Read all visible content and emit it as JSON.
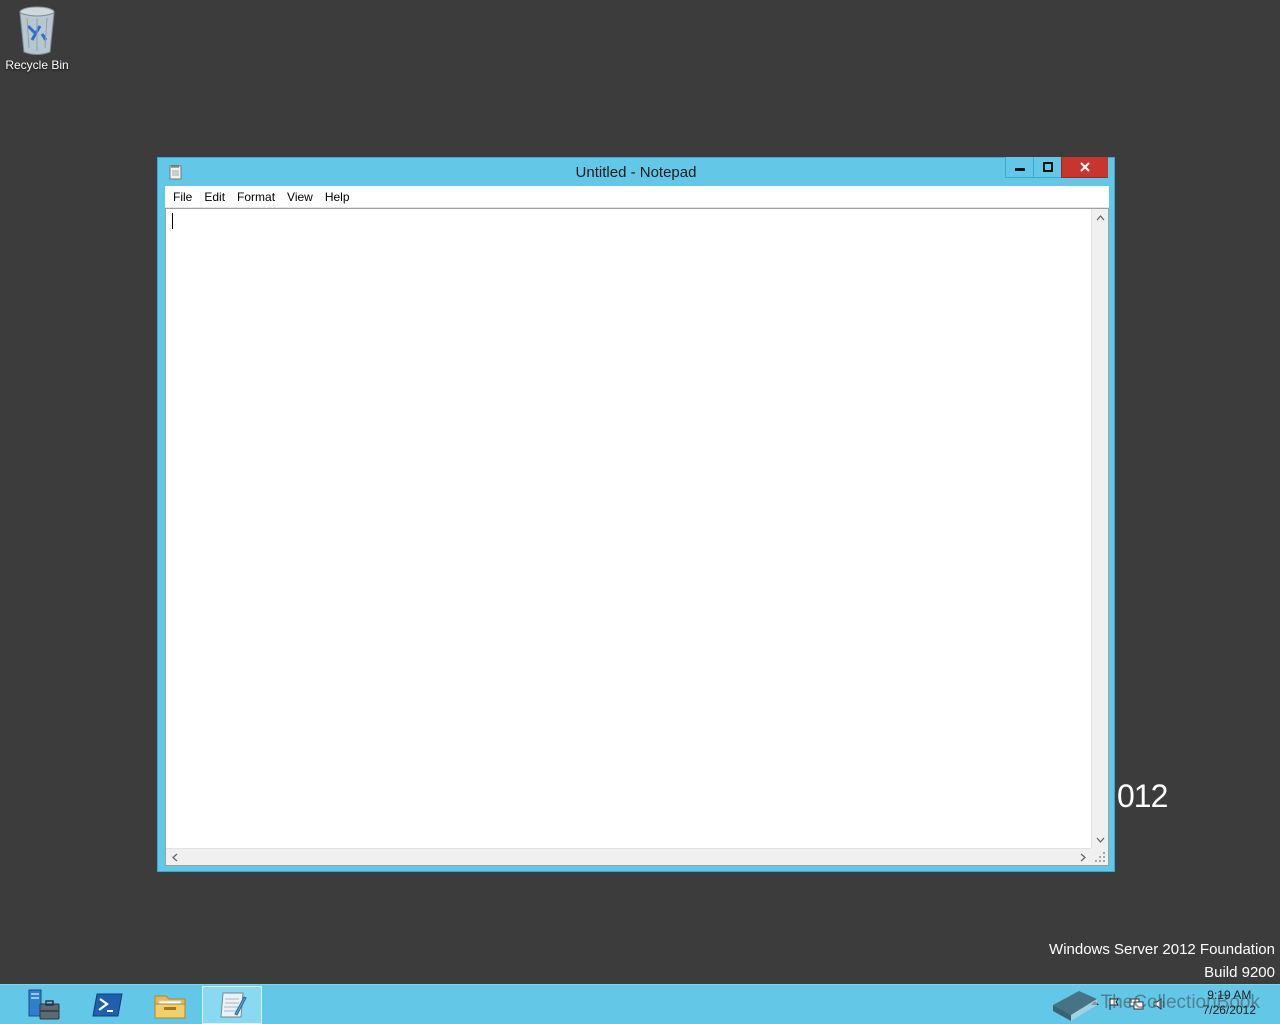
{
  "desktop": {
    "recycle_bin_label": "Recycle Bin",
    "watermark_line1": "Windows Server 2012 Foundation",
    "watermark_line2": "Build 9200",
    "background_fragment": "012"
  },
  "window": {
    "title": "Untitled - Notepad",
    "menu": [
      "File",
      "Edit",
      "Format",
      "View",
      "Help"
    ],
    "text_content": ""
  },
  "taskbar": {
    "buttons": [
      {
        "name": "server-manager",
        "icon": "server-manager-icon"
      },
      {
        "name": "powershell",
        "icon": "powershell-icon"
      },
      {
        "name": "file-explorer",
        "icon": "folder-icon"
      },
      {
        "name": "notepad",
        "icon": "notepad-icon",
        "active": true
      }
    ],
    "clock_time": "9:19 AM",
    "clock_date": "7/26/2012",
    "overlay_text": "TheCollectionBook"
  },
  "colors": {
    "desktop_bg": "#3c3c3c",
    "window_frame": "#63c8e8",
    "close_button": "#c7352c",
    "taskbar": "#63c8e8"
  }
}
